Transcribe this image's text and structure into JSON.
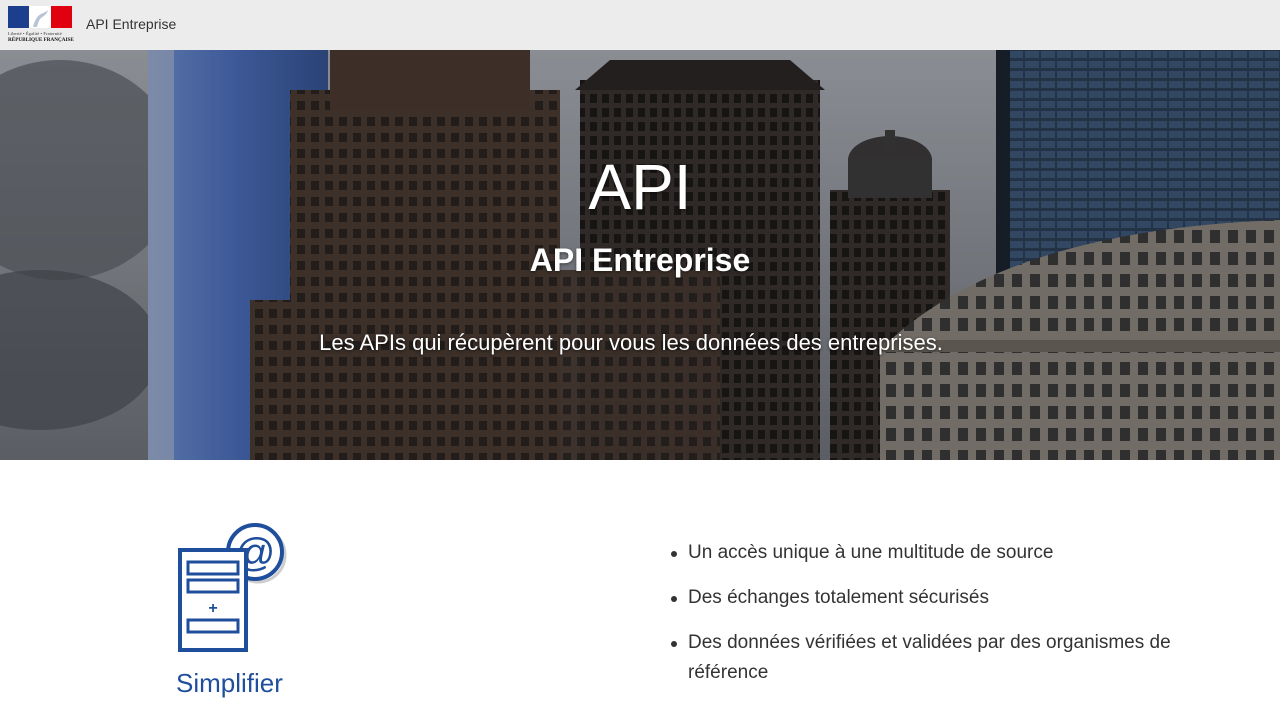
{
  "header": {
    "logo": {
      "motto": "Liberté • Égalité • Fraternité",
      "republic": "RÉPUBLIQUE FRANÇAISE"
    },
    "title": "API Entreprise"
  },
  "hero": {
    "title": "API",
    "subtitle": "API Entreprise",
    "tagline": "Les APIs qui récupèrent pour vous les données des entreprises."
  },
  "feature": {
    "icon": "document-at-icon",
    "label": "Simplifier",
    "bullets": [
      "Un accès unique à une multitude de source",
      "Des échanges totalement sécurisés",
      "Des données vérifiées et validées par des organismes de référence"
    ]
  },
  "colors": {
    "header_bg": "#ececec",
    "accent_blue": "#1f4e9c",
    "flag_blue": "#1b3f8c",
    "flag_red": "#e1000f"
  }
}
